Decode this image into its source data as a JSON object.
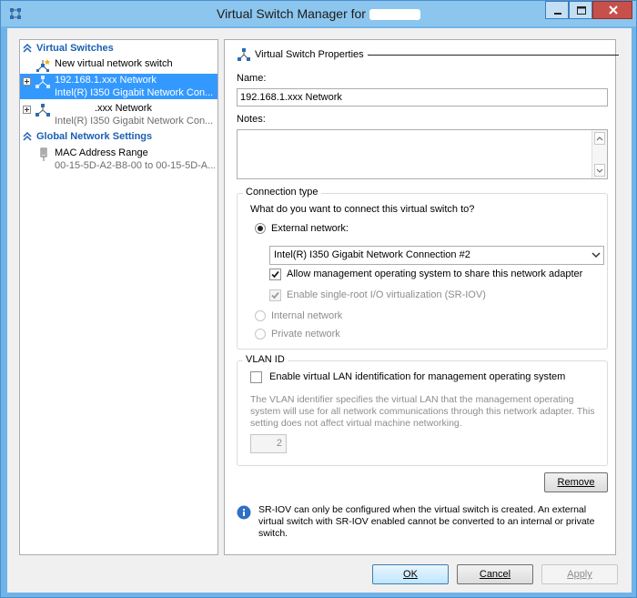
{
  "window": {
    "title": "Virtual Switch Manager for",
    "controls": [
      "minimize",
      "maximize",
      "close"
    ]
  },
  "tree": {
    "virtual_switches_header": "Virtual Switches",
    "new_switch_label": "New virtual network switch",
    "switches": [
      {
        "name": "192.168.1.xxx Network",
        "adapter": "Intel(R) I350 Gigabit Network Con...",
        "selected": true
      },
      {
        "name": ".xxx Network",
        "adapter": "Intel(R) I350 Gigabit Network Con...",
        "selected": false
      }
    ],
    "global_settings_header": "Global Network Settings",
    "mac_range_label": "MAC Address Range",
    "mac_range_value": "00-15-5D-A2-B8-00 to 00-15-5D-A..."
  },
  "properties": {
    "header": "Virtual Switch Properties",
    "name_label": "Name:",
    "name_value": "192.168.1.xxx Network",
    "notes_label": "Notes:",
    "notes_value": "",
    "connection_type": {
      "title": "Connection type",
      "question": "What do you want to connect this virtual switch to?",
      "external_label": "External network:",
      "adapter_selected": "Intel(R) I350 Gigabit Network Connection #2",
      "allow_mgmt_label": "Allow management operating system to share this network adapter",
      "allow_mgmt_checked": true,
      "sriov_label": "Enable single-root I/O virtualization (SR-IOV)",
      "sriov_checked": true,
      "internal_label": "Internal network",
      "private_label": "Private network",
      "selected_type": "external"
    },
    "vlan": {
      "title": "VLAN ID",
      "enable_label": "Enable virtual LAN identification for management operating system",
      "enable_checked": false,
      "description": "The VLAN identifier specifies the virtual LAN that the management operating system will use for all network communications through this network adapter. This setting does not affect virtual machine networking.",
      "vlan_value": "2"
    },
    "remove_label": "Remove",
    "info_text": "SR-IOV can only be configured when the virtual switch is created. An external virtual switch with SR-IOV enabled cannot be converted to an internal or private switch."
  },
  "footer": {
    "ok_label": "OK",
    "cancel_label": "Cancel",
    "apply_label": "Apply"
  },
  "colors": {
    "selection": "#3399ff",
    "section_header": "#1a5fb4",
    "title_bar": "#8cc6ef",
    "close_button": "#c7504b"
  }
}
